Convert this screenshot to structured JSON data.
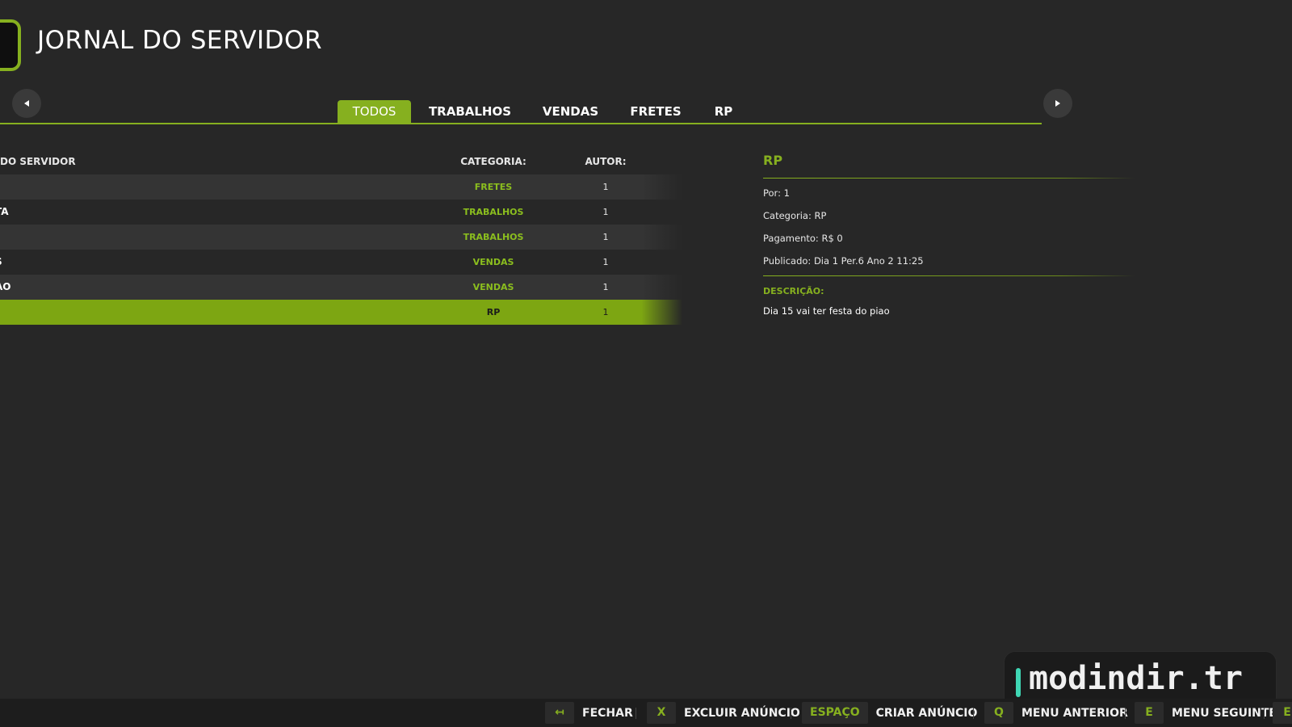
{
  "header": {
    "title": "JORNAL DO SERVIDOR"
  },
  "tabs": [
    {
      "label": "TODOS",
      "active": true
    },
    {
      "label": "TRABALHOS",
      "active": false
    },
    {
      "label": "VENDAS",
      "active": false
    },
    {
      "label": "FRETES",
      "active": false
    },
    {
      "label": "RP",
      "active": false
    }
  ],
  "table": {
    "headers": {
      "title": "DO SERVIDOR",
      "category": "CATEGORIA:",
      "author": "AUTOR:"
    },
    "rows": [
      {
        "title": "",
        "category": "FRETES",
        "author": "1",
        "selected": false
      },
      {
        "title": "TA",
        "category": "TRABALHOS",
        "author": "1",
        "selected": false
      },
      {
        "title": "",
        "category": "TRABALHOS",
        "author": "1",
        "selected": false
      },
      {
        "title": "S",
        "category": "VENDAS",
        "author": "1",
        "selected": false
      },
      {
        "title": "AO",
        "category": "VENDAS",
        "author": "1",
        "selected": false
      },
      {
        "title": "",
        "category": "RP",
        "author": "1",
        "selected": true
      }
    ]
  },
  "details": {
    "title": "RP",
    "por": "Por: 1",
    "categoria": "Categoria: RP",
    "pagamento": "Pagamento: R$ 0",
    "publicado": "Publicado: Dia 1 Per.6 Ano 2 11:25",
    "description_label": "DESCRIÇÃO:",
    "description": "Dia 15 vai ter festa do piao"
  },
  "keybar": [
    {
      "key": "↤",
      "label": "FECHAR"
    },
    {
      "key": "X",
      "label": "EXCLUIR ANÚNCIO"
    },
    {
      "key": "ESPAÇO",
      "label": "CRIAR ANÚNCIO"
    },
    {
      "key": "Q",
      "label": "MENU ANTERIOR"
    },
    {
      "key": "E",
      "label": "MENU SEGUINTE"
    },
    {
      "key": "E",
      "label": ""
    }
  ],
  "watermark": {
    "text": "modindir.tr"
  },
  "colors": {
    "accent": "#86b01f",
    "background": "#272727",
    "selected_row": "#7da612"
  }
}
